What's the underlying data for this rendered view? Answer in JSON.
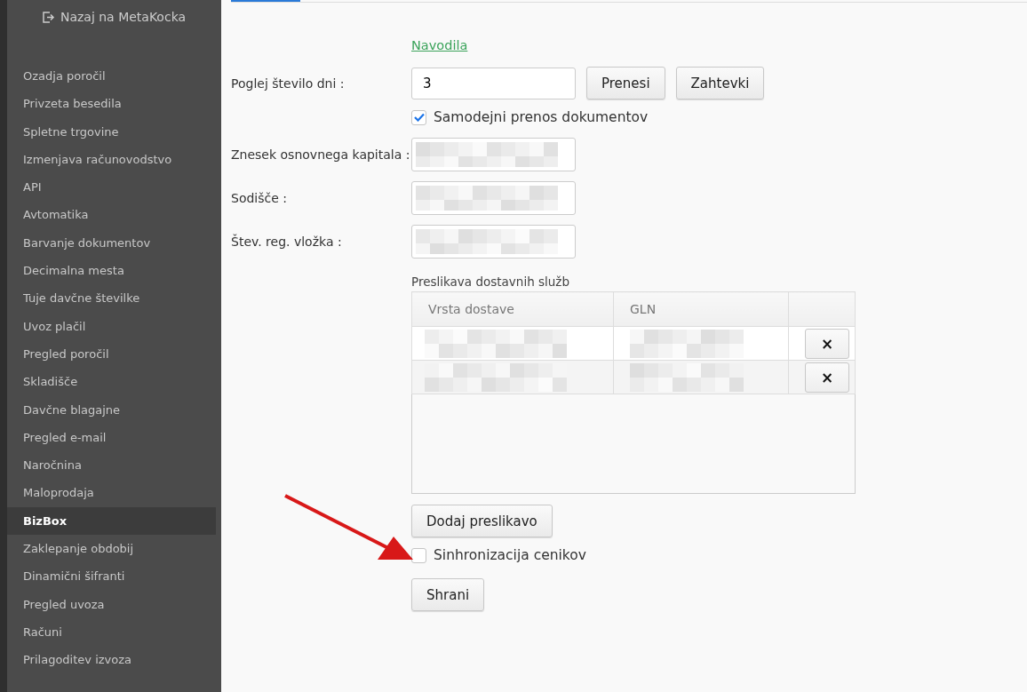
{
  "sidebar": {
    "back_link": "Nazaj na MetaKocka",
    "items": [
      {
        "label": "Ozadja poročil",
        "selected": false
      },
      {
        "label": "Privzeta besedila",
        "selected": false
      },
      {
        "label": "Spletne trgovine",
        "selected": false
      },
      {
        "label": "Izmenjava računovodstvo",
        "selected": false
      },
      {
        "label": "API",
        "selected": false
      },
      {
        "label": "Avtomatika",
        "selected": false
      },
      {
        "label": "Barvanje dokumentov",
        "selected": false
      },
      {
        "label": "Decimalna mesta",
        "selected": false
      },
      {
        "label": "Tuje davčne številke",
        "selected": false
      },
      {
        "label": "Uvoz plačil",
        "selected": false
      },
      {
        "label": "Pregled poročil",
        "selected": false
      },
      {
        "label": "Skladišče",
        "selected": false
      },
      {
        "label": "Davčne blagajne",
        "selected": false
      },
      {
        "label": "Pregled e-mail",
        "selected": false
      },
      {
        "label": "Naročnina",
        "selected": false
      },
      {
        "label": "Maloprodaja",
        "selected": false
      },
      {
        "label": "BizBox",
        "selected": true
      },
      {
        "label": "Zaklepanje obdobij",
        "selected": false
      },
      {
        "label": "Dinamični šifranti",
        "selected": false
      },
      {
        "label": "Pregled uvoza",
        "selected": false
      },
      {
        "label": "Računi",
        "selected": false
      },
      {
        "label": "Prilagoditev izvoza",
        "selected": false
      }
    ]
  },
  "form": {
    "help_link": "Navodila",
    "days": {
      "label": "Poglej število dni :",
      "value": "3",
      "buttons": [
        "Prenesi",
        "Zahtevki"
      ]
    },
    "auto_transfer": {
      "label": "Samodejni prenos dokumentov",
      "checked": true
    },
    "fields": [
      {
        "label": "Znesek osnovnega kapitala :"
      },
      {
        "label": "Sodišče :"
      },
      {
        "label": "Štev. reg. vložka :"
      }
    ],
    "mapping": {
      "title": "Preslikava dostavnih služb",
      "columns": [
        "Vrsta dostave",
        "GLN"
      ],
      "rows": [
        {
          "delete": "×"
        },
        {
          "delete": "×"
        }
      ],
      "add_button": "Dodaj preslikavo"
    },
    "price_sync": {
      "label": "Sinhronizacija cenikov",
      "checked": false
    },
    "save_button": "Shrani"
  }
}
